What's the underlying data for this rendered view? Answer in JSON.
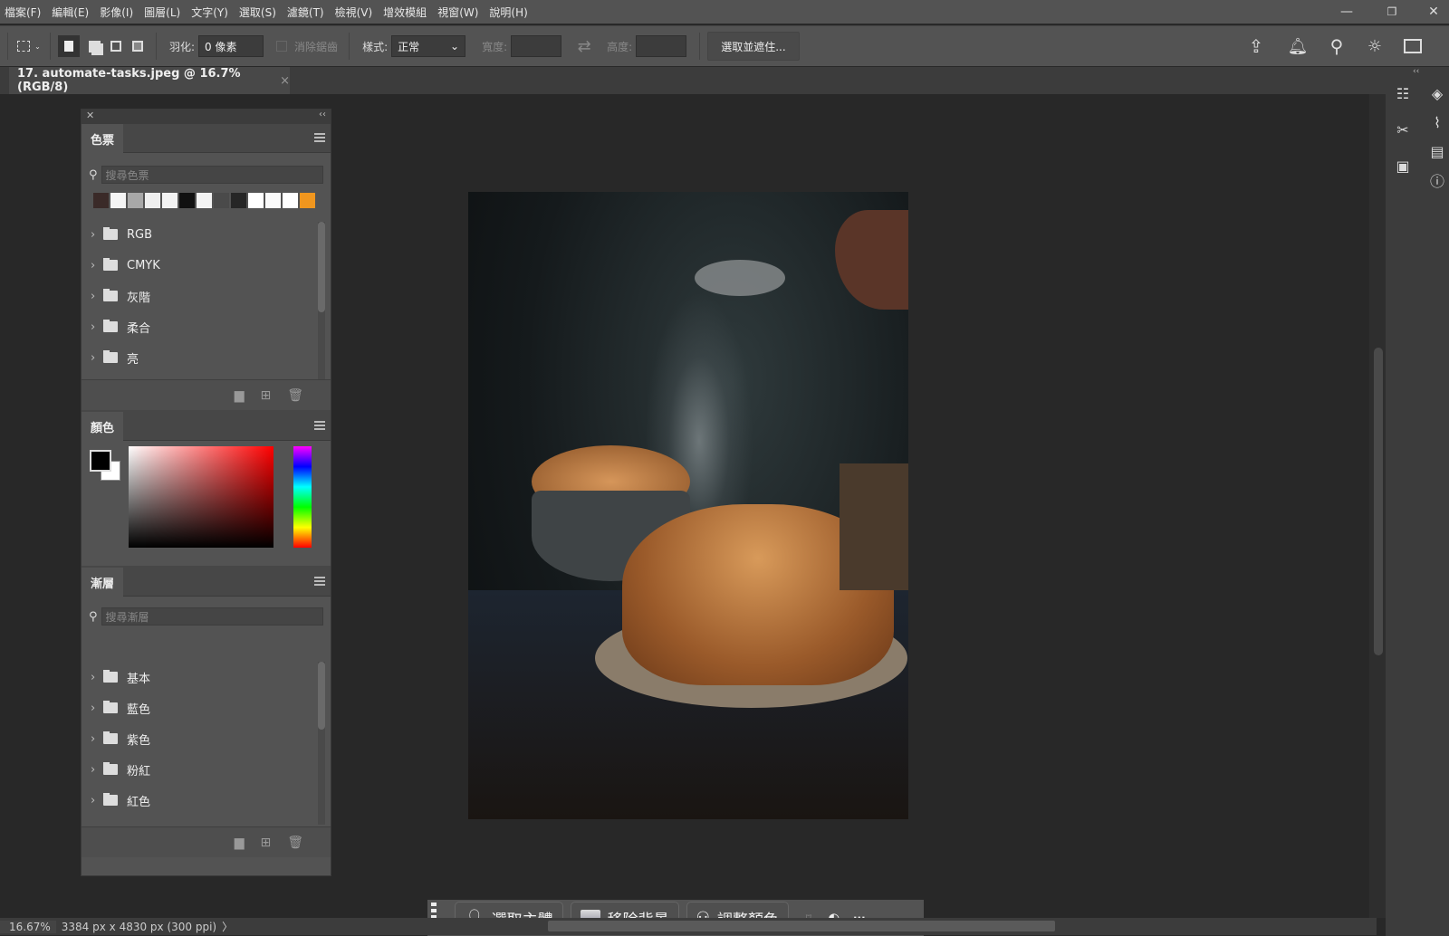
{
  "menubar": {
    "items": [
      "檔案(F)",
      "編輯(E)",
      "影像(I)",
      "圖層(L)",
      "文字(Y)",
      "選取(S)",
      "濾鏡(T)",
      "檢視(V)",
      "增效模組",
      "視窗(W)",
      "說明(H)"
    ],
    "minimize": "—",
    "restore": "❐",
    "close": "✕"
  },
  "options": {
    "feather_label": "羽化:",
    "feather_value": "0 像素",
    "antialias_label": "消除鋸齒",
    "style_label": "樣式:",
    "style_value": "正常",
    "width_label": "寬度:",
    "height_label": "高度:",
    "select_mask_label": "選取並遮住..."
  },
  "document": {
    "tab_title": "17. automate-tasks.jpeg @ 16.7% (RGB/8)",
    "close": "×"
  },
  "swatches": {
    "tab": "色票",
    "search_placeholder": "搜尋色票",
    "colors": [
      "#3a2a28",
      "#f5f5f5",
      "#a8a8a8",
      "#efefef",
      "#f3f3f3",
      "#111111",
      "#f3f3f3",
      "#4a4a4a",
      "#262626",
      "#ffffff",
      "#fafafa",
      "#ffffff",
      "#f0961e"
    ],
    "groups": [
      "RGB",
      "CMYK",
      "灰階",
      "柔合",
      "亮"
    ]
  },
  "color": {
    "tab": "顏色",
    "foreground": "#000000",
    "background": "#ffffff",
    "hue": "#ff0000"
  },
  "gradients": {
    "tab": "漸層",
    "search_placeholder": "搜尋漸層",
    "groups": [
      "基本",
      "藍色",
      "紫色",
      "粉紅",
      "紅色"
    ]
  },
  "contextbar": {
    "select_subject": "選取主體",
    "remove_bg": "移除背景",
    "adjust_color": "調整顏色",
    "more": "···"
  },
  "status": {
    "zoom": "16.67%",
    "dimensions": "3384 px x 4830 px (300 ppi)",
    "arrow": "〉"
  }
}
